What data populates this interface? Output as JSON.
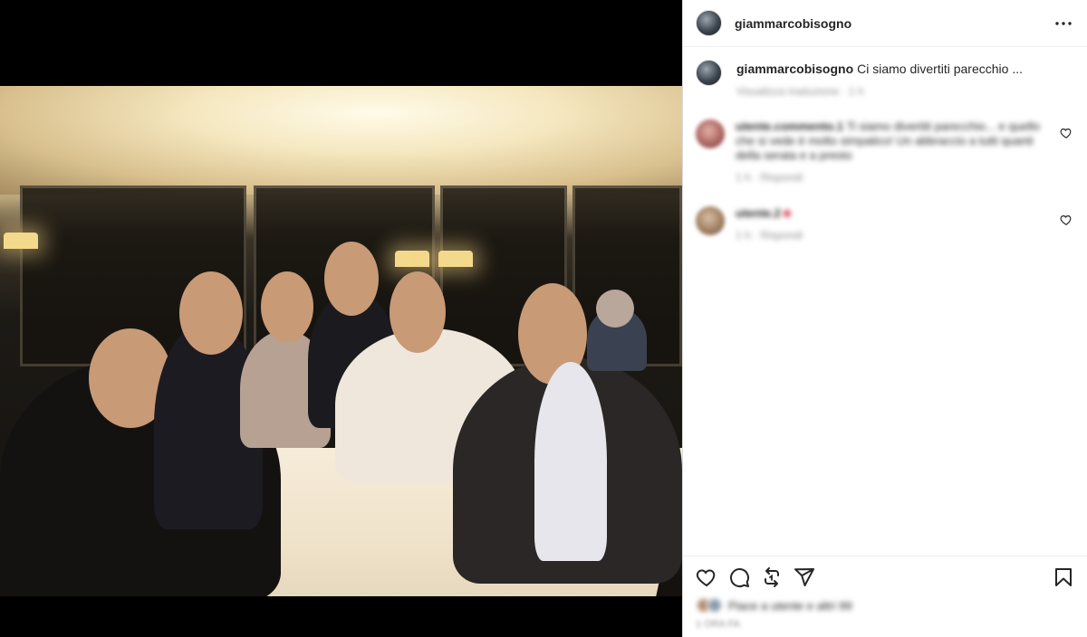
{
  "post": {
    "username": "giammarcobisogno",
    "caption": "Ci siamo divertiti parecchio ...",
    "caption_meta": "Visualizza traduzione · 1 h",
    "more_label": "..."
  },
  "comments": [
    {
      "username": "utente.commento.1",
      "text": "Ti siamo divertiti parecchio... e quello che si vede è molto simpatico! Un abbraccio a tutti quanti della serata e a presto",
      "meta": "1 h · Rispondi"
    },
    {
      "username": "utente.2",
      "text": "",
      "meta": "1 h · Rispondi"
    }
  ],
  "likes": {
    "text": "Piace a utente e altri 99"
  },
  "date": "1 ORA FA",
  "icons": {
    "like": "heart-icon",
    "comment": "comment-icon",
    "repost": "repost-icon",
    "share": "share-icon",
    "save": "bookmark-icon",
    "more": "more-icon"
  }
}
